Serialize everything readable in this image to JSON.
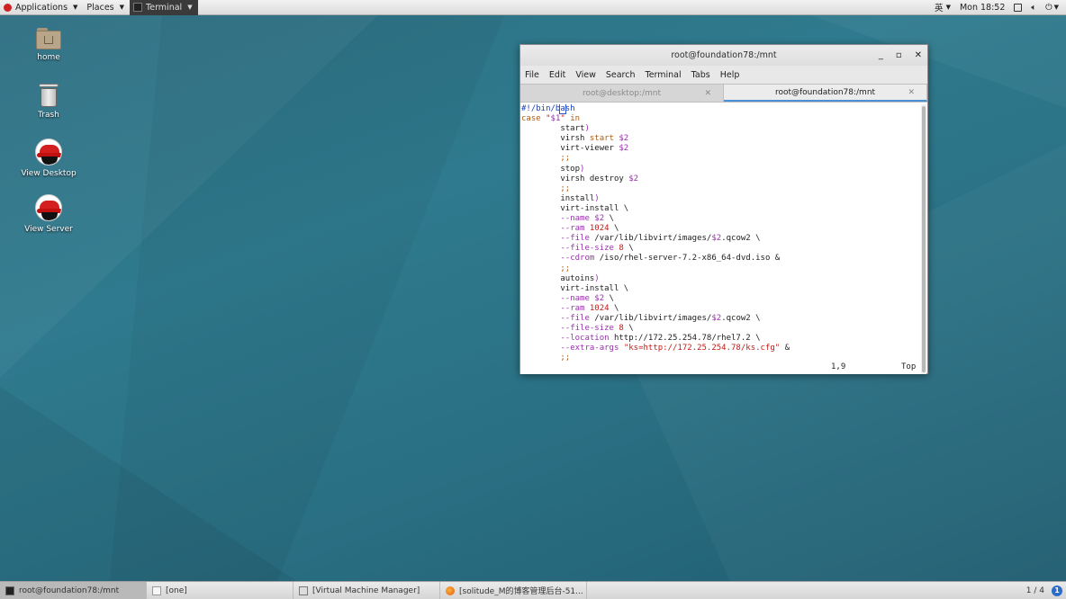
{
  "topbar": {
    "applications": "Applications",
    "places": "Places",
    "terminal": "Terminal",
    "input_method": "英",
    "clock": "Mon 18:52"
  },
  "desktop": {
    "icons": [
      {
        "label": "home",
        "icon": "folder-home-icon"
      },
      {
        "label": "Trash",
        "icon": "trash-icon"
      },
      {
        "label": "View Desktop",
        "icon": "redhat-icon"
      },
      {
        "label": "View Server",
        "icon": "redhat-icon"
      }
    ]
  },
  "window": {
    "title": "root@foundation78:/mnt",
    "menu": [
      "File",
      "Edit",
      "View",
      "Search",
      "Terminal",
      "Tabs",
      "Help"
    ],
    "tabs": [
      {
        "label": "root@desktop:/mnt",
        "active": false
      },
      {
        "label": "root@foundation78:/mnt",
        "active": true
      }
    ],
    "status_pos": "1,9",
    "status_scroll": "Top"
  },
  "taskbar": {
    "items": [
      {
        "label": "root@foundation78:/mnt",
        "active": true
      },
      {
        "label": "[one]",
        "active": false
      },
      {
        "label": "[Virtual Machine Manager]",
        "active": false
      },
      {
        "label": "[solitude_M的博客管理后台-51...",
        "active": false
      }
    ],
    "pager": "1 / 4"
  },
  "colors": {
    "desktop_bg": "#2f7a8e",
    "accent_tab": "#4a90d9"
  }
}
